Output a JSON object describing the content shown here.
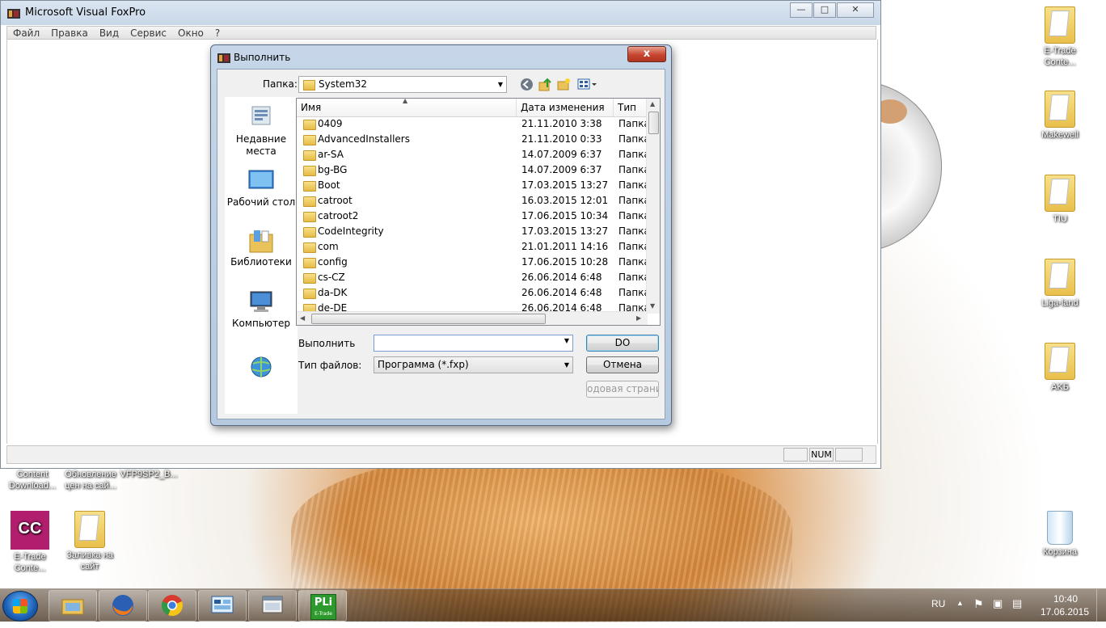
{
  "desktop": {
    "icons": [
      {
        "label": "E-Trade Conte...",
        "type": "folder"
      },
      {
        "label": "Makewell",
        "type": "folder"
      },
      {
        "label": "TIU",
        "type": "folder"
      },
      {
        "label": "Liga-land",
        "type": "folder"
      },
      {
        "label": "AKБ",
        "type": "folder"
      },
      {
        "label": "Корзина",
        "type": "recycle-bin"
      }
    ],
    "left_icons": [
      {
        "label": "Content Download..."
      },
      {
        "label": "Обновление цен на сай..."
      },
      {
        "label": "VFP9SP2_B..."
      },
      {
        "label": "E-Trade Conte...",
        "badge": "CC",
        "sub": "E-Trade"
      },
      {
        "label": "Заливка на сайт"
      }
    ]
  },
  "vfp": {
    "title": "Microsoft Visual FoxPro",
    "menu": [
      "Файл",
      "Правка",
      "Вид",
      "Сервис",
      "Окно",
      "?"
    ],
    "controls": {
      "minimize": "—",
      "maximize": "□",
      "close": "✕"
    },
    "status": {
      "num": "NUM"
    }
  },
  "dialog": {
    "title": "Выполнить",
    "close": "x",
    "folder_label": "Папка:",
    "folder_value": "System32",
    "places": [
      {
        "label": "Недавние места"
      },
      {
        "label": "Рабочий стол"
      },
      {
        "label": "Библиотеки"
      },
      {
        "label": "Компьютер"
      },
      {
        "label": ""
      }
    ],
    "columns": [
      "Имя",
      "Дата изменения",
      "Тип"
    ],
    "files": [
      {
        "name": "0409",
        "date": "21.11.2010 3:38",
        "type": "Папка"
      },
      {
        "name": "AdvancedInstallers",
        "date": "21.11.2010 0:33",
        "type": "Папка"
      },
      {
        "name": "ar-SA",
        "date": "14.07.2009 6:37",
        "type": "Папка"
      },
      {
        "name": "bg-BG",
        "date": "14.07.2009 6:37",
        "type": "Папка"
      },
      {
        "name": "Boot",
        "date": "17.03.2015 13:27",
        "type": "Папка"
      },
      {
        "name": "catroot",
        "date": "16.03.2015 12:01",
        "type": "Папка"
      },
      {
        "name": "catroot2",
        "date": "17.06.2015 10:34",
        "type": "Папка"
      },
      {
        "name": "CodeIntegrity",
        "date": "17.03.2015 13:27",
        "type": "Папка"
      },
      {
        "name": "com",
        "date": "21.01.2011 14:16",
        "type": "Папка"
      },
      {
        "name": "config",
        "date": "17.06.2015 10:28",
        "type": "Папка"
      },
      {
        "name": "cs-CZ",
        "date": "26.06.2014 6:48",
        "type": "Папка"
      },
      {
        "name": "da-DK",
        "date": "26.06.2014 6:48",
        "type": "Папка"
      },
      {
        "name": "de-DE",
        "date": "26.06.2014 6:48",
        "type": "Папка"
      }
    ],
    "run_label": "Выполнить",
    "run_value": "",
    "filetype_label": "Тип файлов:",
    "filetype_value": "Программа (*.fxp)",
    "buttons": {
      "do": "DO",
      "cancel": "Отмена",
      "code_page": "одовая страница..."
    }
  },
  "taskbar": {
    "apps": [
      "explorer",
      "firefox",
      "chrome",
      "control-panel",
      "window-app",
      "PLi"
    ],
    "pli_label": "PLi",
    "pli_sub": "E-Trade",
    "lang": "RU",
    "time": "10:40",
    "date": "17.06.2015"
  }
}
